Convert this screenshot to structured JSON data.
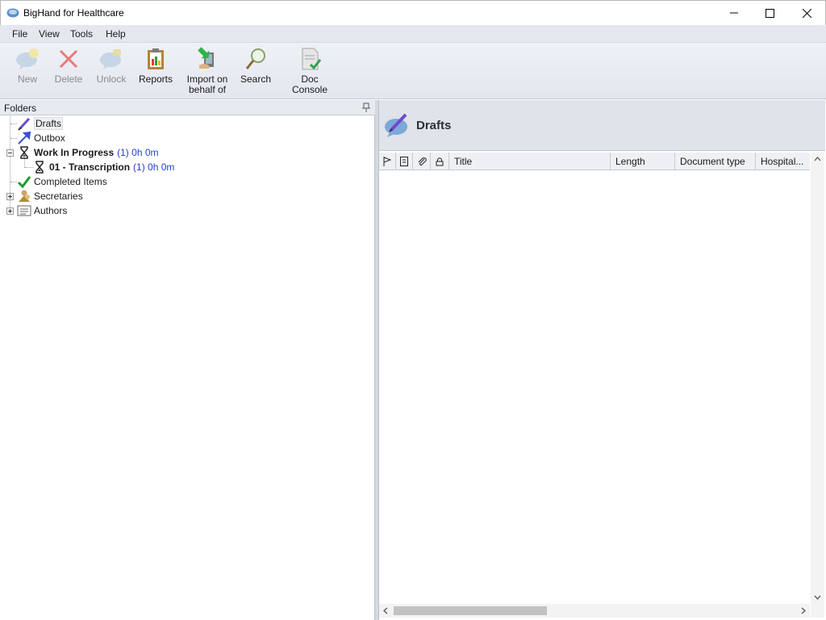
{
  "window": {
    "title": "BigHand for Healthcare",
    "controls": [
      "minimize",
      "maximize",
      "close"
    ]
  },
  "menu": [
    "File",
    "View",
    "Tools",
    "Help"
  ],
  "toolbar": {
    "buttons": [
      {
        "label": "New",
        "icon": "new-bubble-icon",
        "enabled": false
      },
      {
        "label": "Delete",
        "icon": "delete-x-icon",
        "enabled": false
      },
      {
        "label": "Unlock",
        "icon": "unlock-bubble-icon",
        "enabled": false
      },
      {
        "label": "Reports",
        "icon": "clipboard-report-icon",
        "enabled": true
      },
      {
        "label": "Import on behalf of",
        "icon": "import-arrow-icon",
        "enabled": true
      },
      {
        "label": "Search",
        "icon": "magnifier-icon",
        "enabled": true
      },
      {
        "label": "Doc Console",
        "icon": "document-check-icon",
        "enabled": true
      }
    ]
  },
  "folders": {
    "header": "Folders",
    "items": [
      {
        "label": "Drafts",
        "icon": "pen-icon",
        "selected": true
      },
      {
        "label": "Outbox",
        "icon": "arrow-up-right-icon"
      },
      {
        "label": "Work In Progress",
        "meta": "(1) 0h 0m",
        "icon": "hourglass-icon",
        "bold": true,
        "expanded": true
      },
      {
        "label": "01 - Transcription",
        "meta": "(1) 0h 0m",
        "icon": "hourglass-icon",
        "bold": true,
        "child": true
      },
      {
        "label": "Completed Items",
        "icon": "green-check-icon"
      },
      {
        "label": "Secretaries",
        "icon": "people-icon",
        "expandable": true
      },
      {
        "label": "Authors",
        "icon": "list-icon",
        "expandable": true
      }
    ]
  },
  "content": {
    "title": "Drafts",
    "columns": [
      "Title",
      "Length",
      "Document type",
      "Hospital..."
    ],
    "icon_columns": [
      "flag-icon",
      "document-icon",
      "attachment-icon",
      "lock-icon"
    ],
    "rows": []
  },
  "colors": {
    "accent_link": "#1f3fd6",
    "header_bg": "#dfe3ea",
    "toolbar_bg": "#e3e7ee"
  }
}
